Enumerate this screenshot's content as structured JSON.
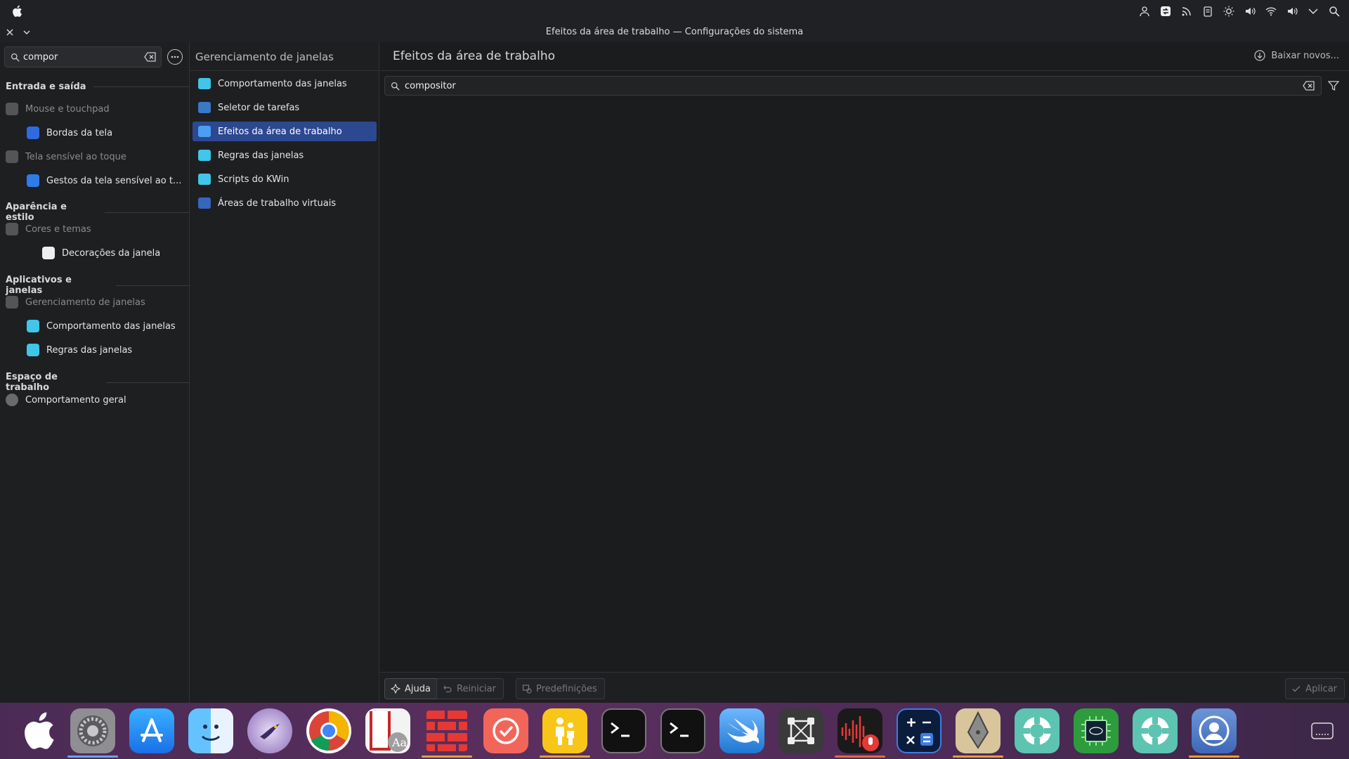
{
  "window": {
    "title": "Efeitos da área de trabalho — Configurações do sistema"
  },
  "sidebar": {
    "search_value": "compor",
    "sections": [
      {
        "heading": "Entrada e saída"
      },
      {
        "heading": "Aparência e estilo"
      },
      {
        "heading": "Aplicativos e janelas"
      },
      {
        "heading": "Espaço de trabalho"
      }
    ],
    "items": [
      {
        "label": "Mouse e touchpad"
      },
      {
        "label": "Bordas da tela"
      },
      {
        "label": "Tela sensível ao toque"
      },
      {
        "label": "Gestos da tela sensível ao t..."
      },
      {
        "label": "Cores e temas"
      },
      {
        "label": "Decorações da janela"
      },
      {
        "label": "Gerenciamento de janelas"
      },
      {
        "label": "Comportamento das janelas"
      },
      {
        "label": "Regras das janelas"
      },
      {
        "label": "Comportamento geral"
      }
    ]
  },
  "middle": {
    "header": "Gerenciamento de janelas",
    "items": [
      {
        "label": "Comportamento das janelas"
      },
      {
        "label": "Seletor de tarefas"
      },
      {
        "label": "Efeitos da área de trabalho"
      },
      {
        "label": "Regras das janelas"
      },
      {
        "label": "Scripts do KWin"
      },
      {
        "label": "Áreas de trabalho virtuais"
      }
    ]
  },
  "main": {
    "title": "Efeitos da área de trabalho",
    "download_label": "Baixar novos...",
    "filter_value": "compositor"
  },
  "footer": {
    "help": "Ajuda",
    "reset": "Reiniciar",
    "defaults": "Predefinições",
    "apply": "Aplicar"
  },
  "colors": {
    "accent": "#2c4890",
    "folder_cyan": "#3fc6e8",
    "dock_bg": "#4b2b55"
  },
  "dock": {
    "icons": [
      "apple-icon",
      "system-settings-icon",
      "app-store-icon",
      "finder-icon",
      "bird-browser-icon",
      "chrome-icon",
      "dictionary-icon",
      "brick-app-icon",
      "tasks-icon",
      "family-icon",
      "terminal-icon",
      "terminal-2-icon",
      "swift-icon",
      "vector-app-icon",
      "voice-recorder-icon",
      "calculator-icon",
      "pen-tool-icon",
      "lifebuoy-icon",
      "intel-chip-icon",
      "lifebuoy-2-icon",
      "user-accounts-icon",
      "menu-icon"
    ]
  }
}
